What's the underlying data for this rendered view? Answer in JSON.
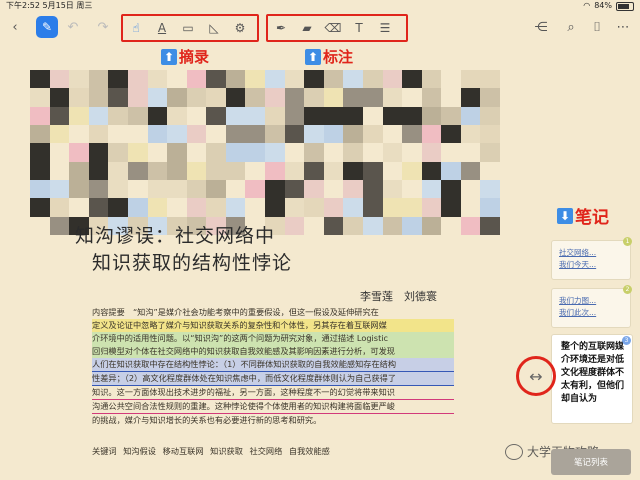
{
  "status_bar": {
    "time": "下午2:52",
    "date": "5月15日 周三",
    "battery": "84%"
  },
  "toolbar": {
    "excerpt_tools": [
      "select",
      "text",
      "box",
      "lasso",
      "settings"
    ],
    "annotate_tools": [
      "pen",
      "highlighter",
      "eraser",
      "textbox",
      "note"
    ]
  },
  "hints": {
    "excerpt": "摘录",
    "annotate": "标注",
    "notes": "笔记"
  },
  "document": {
    "title_line1": "知沟谬误：社交网络中",
    "title_line2": "知识获取的结构性悖论",
    "authors": "李雪莲　刘德寰",
    "abstract": [
      "内容提要　“知沟”是媒介社会功能考察中的重要假设，但这一假设及延伸研究在",
      "定义及论证中忽略了媒介与知识获取关系的复杂性和个体性，另其存在着互联网媒",
      "介环境中的适用性问题。以“知识沟”的这两个问题为研究对象，通过描述 Logistic",
      "回归模型对个体在社交网络中的知识获取自我效能感及其影响因素进行分析，可发现",
      "人们在知识获取中存在结构性悖论：（1）不同群体知识获取的自我效能感知存在结构",
      "性差异；（2）高文化程度群体处在知识焦虑中，而低文化程度群体则认为自己获得了",
      "知识。这一方面体现出技术进步的福祉，另一方面，这种程度不一的幻觉将带来知识",
      "沟通公共空间合法性规则的重建。这种悖论使得个体使用者的知识构建将面临更严峻",
      "的挑战，媒介与知识增长的关系也有必要进行新的思考和研究。"
    ],
    "keywords_label": "关键词",
    "keywords": [
      "知沟假设",
      "移动互联网",
      "知识获取",
      "社交网络",
      "自我效能感"
    ]
  },
  "notes": {
    "cards": [
      {
        "lines": [
          "社交网络...",
          "我们今天..."
        ],
        "badge": "1"
      },
      {
        "lines": [
          "我们力图...",
          "我们此次..."
        ],
        "badge": "2"
      }
    ],
    "active_card": {
      "text": "整个的互联网媒介环境还是对低文化程度群体不太有利，但他们却自认为",
      "badge": "3"
    },
    "list_button": "笔记列表"
  },
  "watermark": "大学干物攻略",
  "colors": {
    "accent": "#2b7de9",
    "hint_red": "#e0251b",
    "page_bg": "#f4e9cf"
  }
}
